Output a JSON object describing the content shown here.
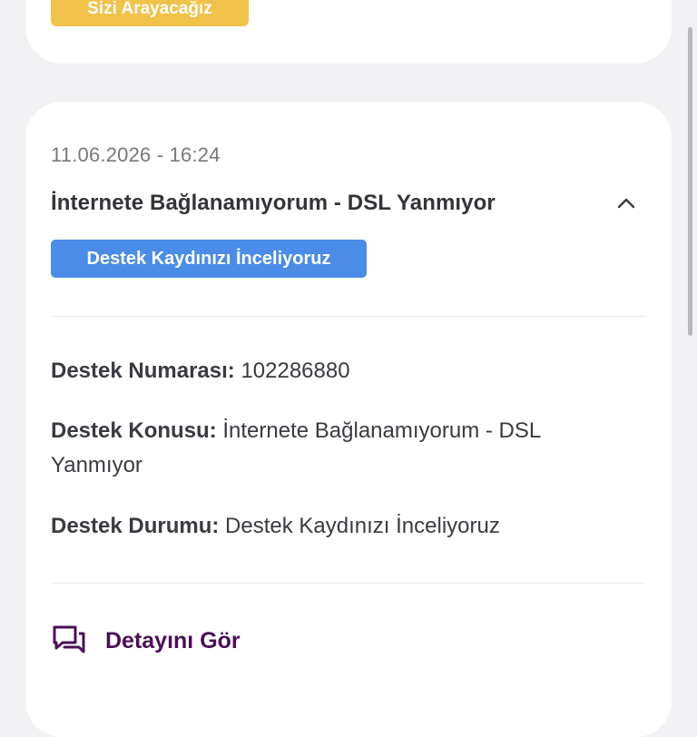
{
  "top_card": {
    "call_button_label": "Sizi Arayacağız"
  },
  "ticket": {
    "date": "11.06.2026 - 16:24",
    "title": "İnternete Bağlanamıyorum - DSL Yanmıyor",
    "status_badge": "Destek Kaydınızı İnceliyoruz",
    "status_badge_color": "#4a8ce8",
    "details": [
      {
        "label": "Destek Numarası:",
        "value": "102286880"
      },
      {
        "label": "Destek Konusu:",
        "value": "İnternete Bağlanamıyorum - DSL Yanmıyor"
      },
      {
        "label": "Destek Durumu:",
        "value": "Destek Kaydınızı İnceliyoruz"
      }
    ],
    "detail_link_label": "Detayını Gör",
    "detail_link_icon": "chat-bubbles-icon",
    "collapse_icon": "chevron-up-icon",
    "accent_color": "#4a0f55"
  }
}
